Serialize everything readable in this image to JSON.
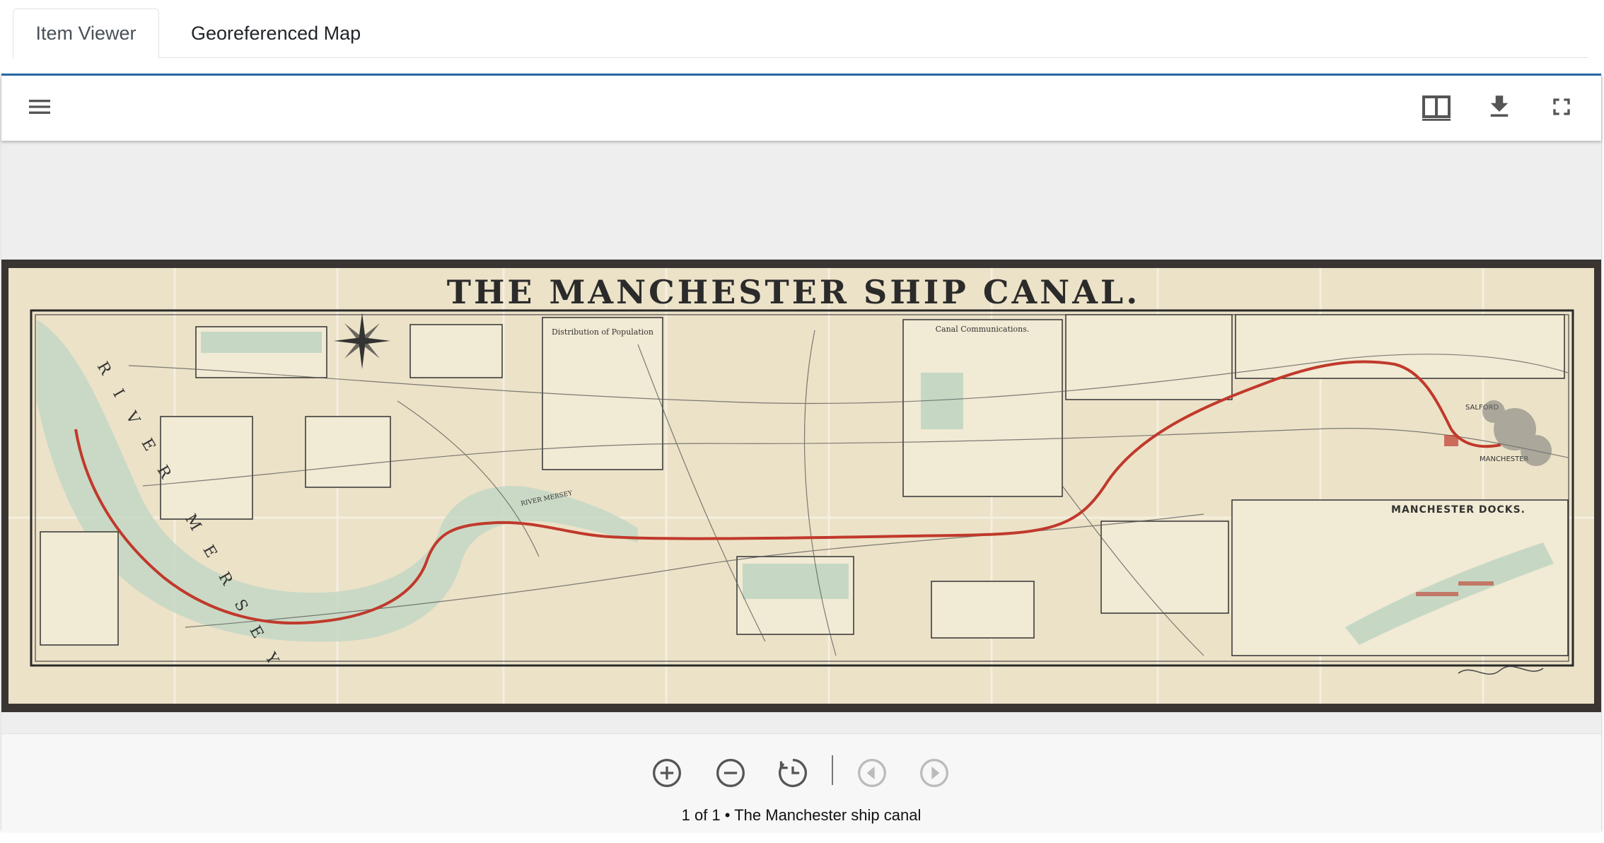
{
  "tabs": [
    {
      "label": "Item Viewer",
      "active": true
    },
    {
      "label": "Georeferenced Map",
      "active": false
    }
  ],
  "toolbar": {
    "icons": [
      "menu-icon",
      "book-view-icon",
      "download-icon",
      "fullscreen-icon"
    ]
  },
  "map": {
    "title": "THE MANCHESTER SHIP CANAL.",
    "labels": {
      "population": "Distribution of Population",
      "communications": "Canal Communications.",
      "docks": "MANCHESTER DOCKS.",
      "salford": "SALFORD",
      "manchester": "MANCHESTER",
      "river_mersey": "RIVER MERSEY",
      "river_mersey_small": "RIVER MERSEY"
    }
  },
  "controls": {
    "icons": [
      "zoom-in-icon",
      "zoom-out-icon",
      "reset-zoom-icon",
      "previous-icon",
      "next-icon"
    ]
  },
  "caption": {
    "page": "1 of 1",
    "separator": "•",
    "title": "The Manchester ship canal"
  },
  "colors": {
    "accent": "#2b6aa6",
    "canal": "#c0392b",
    "paper": "#ece2c8",
    "water": "#c6d8c4"
  }
}
